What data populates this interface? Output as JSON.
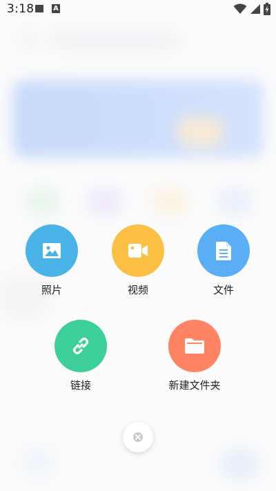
{
  "status_bar": {
    "time": "3:18",
    "notification_letter": "A",
    "icons": [
      "image-icon",
      "a-badge-icon",
      "wifi-icon",
      "signal-icon",
      "battery-charging-icon"
    ]
  },
  "actions": {
    "photo": {
      "label": "照片",
      "color": "#49b3e8",
      "icon": "image-icon"
    },
    "video": {
      "label": "视频",
      "color": "#fbbf43",
      "icon": "video-camera-icon"
    },
    "file": {
      "label": "文件",
      "color": "#5aaef5",
      "icon": "document-icon"
    },
    "link": {
      "label": "链接",
      "color": "#3ccf99",
      "icon": "link-icon"
    },
    "new_folder": {
      "label": "新建文件夹",
      "color": "#ff8463",
      "icon": "folder-icon"
    }
  },
  "close": {
    "icon": "close-icon"
  }
}
